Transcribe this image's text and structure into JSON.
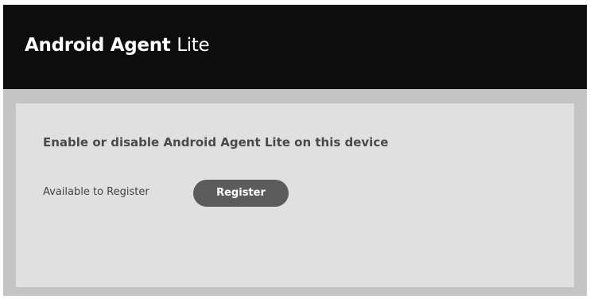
{
  "header": {
    "title_bold": "Android Agent",
    "title_light": "Lite"
  },
  "main": {
    "heading": "Enable or disable Android Agent Lite on this device",
    "status_label": "Available to Register",
    "register_label": "Register"
  },
  "colors": {
    "header_background": "#0d0d0d",
    "window_background": "#c4c4c4",
    "panel_background": "#e0e0e0",
    "button_background": "#5c5c5c",
    "button_text": "#ffffff"
  }
}
